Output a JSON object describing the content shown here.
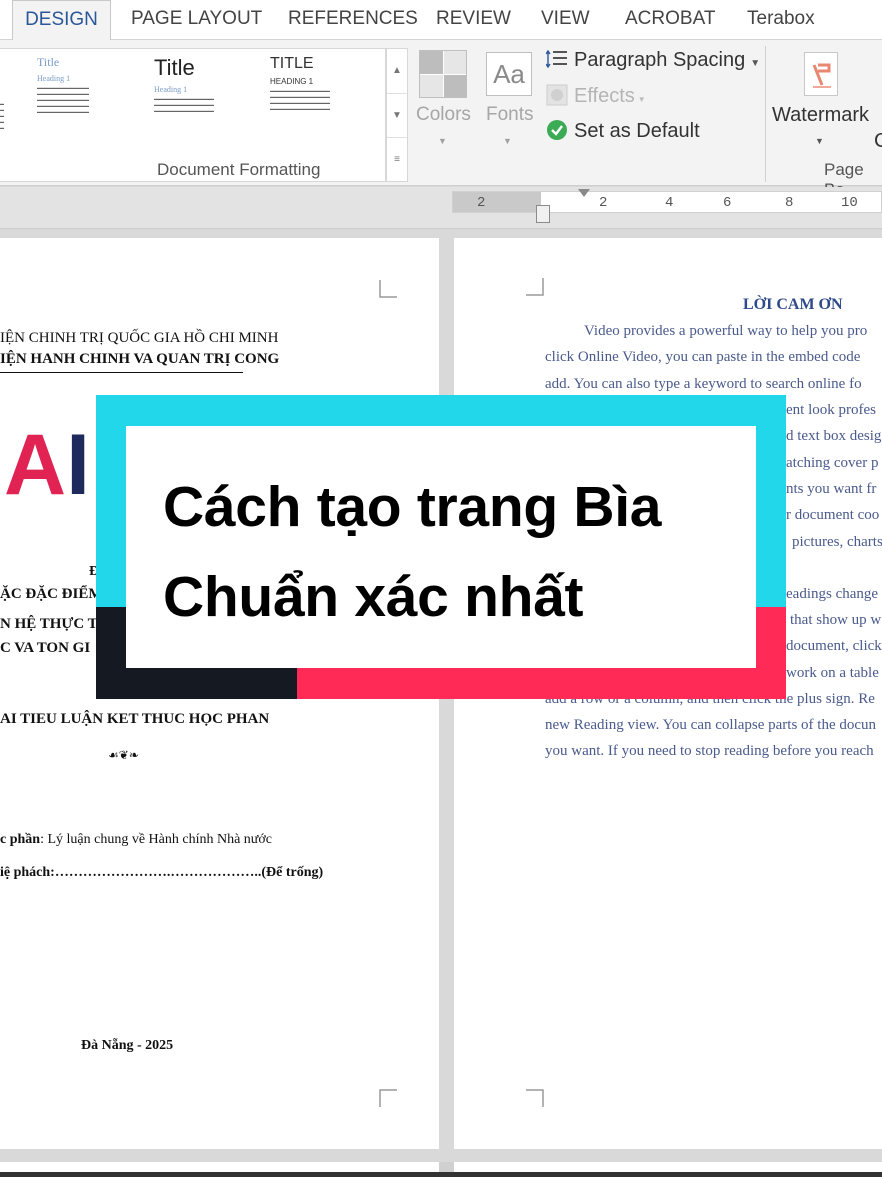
{
  "ribbon_tabs": [
    {
      "label": "DESIGN",
      "active": true
    },
    {
      "label": "PAGE LAYOUT",
      "active": false
    },
    {
      "label": "REFERENCES",
      "active": false
    },
    {
      "label": "REVIEW",
      "active": false
    },
    {
      "label": "VIEW",
      "active": false
    },
    {
      "label": "ACROBAT",
      "active": false
    },
    {
      "label": "Terabox",
      "active": false
    }
  ],
  "style_gallery": [
    {
      "title": "Title",
      "heading": "Heading 1"
    },
    {
      "title": "Title",
      "heading": "Heading 1"
    },
    {
      "title": "TITLE",
      "heading": "HEADING 1"
    }
  ],
  "design_group": {
    "colors_label": "Colors",
    "fonts_label": "Fonts",
    "fonts_sample": "Aa",
    "paragraph_spacing": "Paragraph Spacing",
    "effects": "Effects",
    "set_as_default": "Set as Default",
    "group_label": "Document Formatting"
  },
  "page_background": {
    "watermark": "Watermark",
    "fragment": "C",
    "group_label": "Page Ba"
  },
  "ruler_ticks": [
    "2",
    "2",
    "4",
    "6",
    "8",
    "10"
  ],
  "left_page": {
    "org_line1": "IỆN CHINH TRỊ QUỐC GIA HỒ CHI MINH",
    "org_line2": "IỆN HANH CHINH VA QUAN TRỊ CONG",
    "logo_a": "A",
    "logo_b": "I",
    "frag_d": "Đ",
    "frag_1": "ẶC ĐẶC ĐIỂM",
    "frag_2": "N HỆ THỰC T",
    "frag_3": "C VA TON GI",
    "essay_title": "AI TIEU LUẬN KET THUC HỌC PHAN",
    "ornament": "☙❦❧",
    "course_label": "c phần",
    "course_value": ": Lý luận chung về Hành chính Nhà nước",
    "lecturer": "iệ phách:…………………….………………..(Để trống)",
    "footer": "Đà Nẵng - 2025"
  },
  "right_page": {
    "heading": "LỜI CAM ƠN",
    "lines": [
      "Video provides a powerful way to help you pro",
      "click Online Video, you can paste in the embed code",
      "add. You can also type a keyword to search online fo",
      "ent look profes",
      "d text box desig",
      "atching cover p",
      "nts you want fr",
      "r document coo",
      "pictures, charts",
      "eadings change",
      "that show up w",
      "document, click",
      "work on a table",
      "add a row or a column, and then click the plus sign. Re",
      "new Reading view. You can collapse parts of the docun",
      "you want. If you need to stop reading before you reach"
    ]
  },
  "overlay": {
    "line1": "Cách tạo trang Bìa",
    "line2": "Chuẩn xác nhất"
  }
}
